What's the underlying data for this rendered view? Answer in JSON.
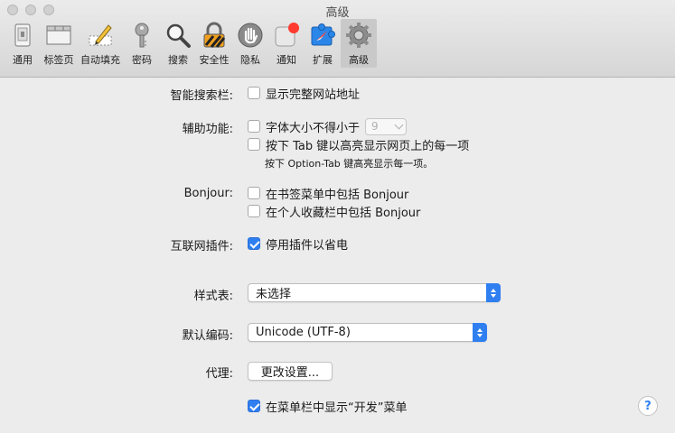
{
  "window": {
    "title": "高级"
  },
  "toolbar": {
    "items": [
      {
        "label": "通用",
        "icon": "general-icon"
      },
      {
        "label": "标签页",
        "icon": "tabs-icon"
      },
      {
        "label": "自动填充",
        "icon": "autofill-icon"
      },
      {
        "label": "密码",
        "icon": "key-icon"
      },
      {
        "label": "搜索",
        "icon": "magnifier-icon"
      },
      {
        "label": "安全性",
        "icon": "lock-icon"
      },
      {
        "label": "隐私",
        "icon": "hand-icon"
      },
      {
        "label": "通知",
        "icon": "notification-icon"
      },
      {
        "label": "扩展",
        "icon": "extension-icon"
      },
      {
        "label": "高级",
        "icon": "gear-icon"
      }
    ],
    "selected": "高级"
  },
  "smart_search": {
    "label": "智能搜索栏:",
    "show_full_address": "显示完整网站地址",
    "checked": false
  },
  "accessibility": {
    "label": "辅助功能:",
    "min_font": "字体大小不得小于",
    "min_font_value": "9",
    "tab_highlight": "按下 Tab 键以高亮显示网页上的每一项",
    "tab_hint": "按下 Option-Tab 键高亮显示每一项。"
  },
  "bonjour": {
    "label": "Bonjour:",
    "bookmarks_menu": "在书签菜单中包括 Bonjour",
    "favorites_bar": "在个人收藏栏中包括 Bonjour"
  },
  "plugins": {
    "label": "互联网插件:",
    "stop_plugins": "停用插件以省电",
    "checked": true
  },
  "stylesheet": {
    "label": "样式表:",
    "value": "未选择"
  },
  "encoding": {
    "label": "默认编码:",
    "value": "Unicode (UTF-8)"
  },
  "proxy": {
    "label": "代理:",
    "button": "更改设置..."
  },
  "develop_menu": {
    "label": "在菜单栏中显示“开发”菜单",
    "checked": true
  },
  "help": {
    "label": "?"
  },
  "colors": {
    "accent": "#2f7ff1"
  }
}
